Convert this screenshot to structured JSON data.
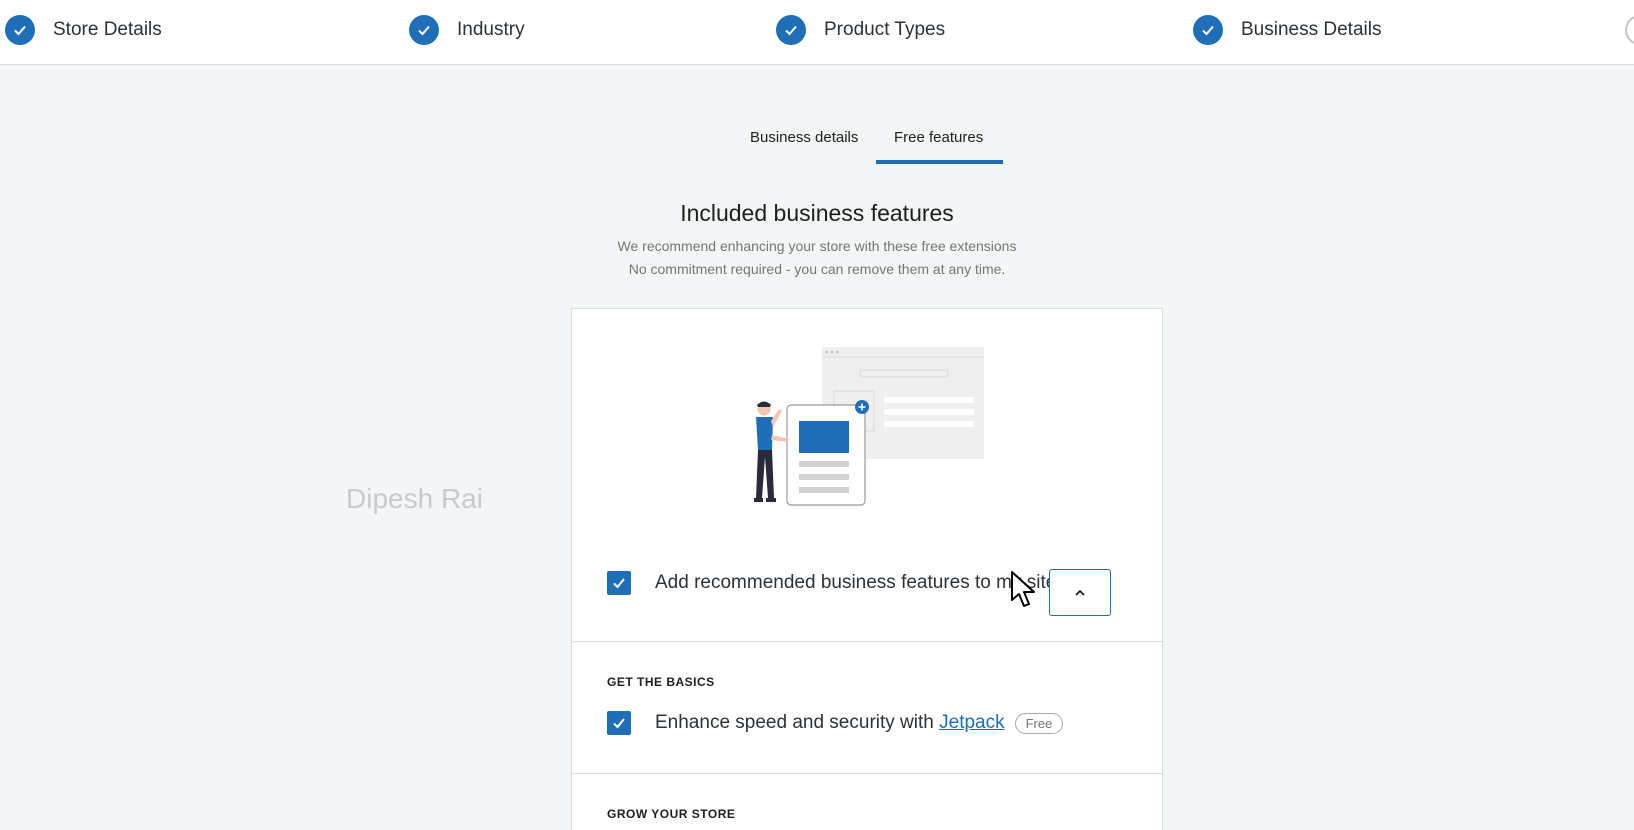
{
  "stepper": {
    "steps": [
      {
        "label": "Store Details"
      },
      {
        "label": "Industry"
      },
      {
        "label": "Product Types"
      },
      {
        "label": "Business Details"
      }
    ]
  },
  "tabs": [
    {
      "label": "Business details",
      "active": false
    },
    {
      "label": "Free features",
      "active": true
    }
  ],
  "header": {
    "title": "Included business features",
    "subtitle_line1": "We recommend enhancing your store with these free extensions",
    "subtitle_line2": "No commitment required - you can remove them at any time."
  },
  "watermark": "Dipesh Rai",
  "card": {
    "main_option": {
      "label": "Add recommended business features to my site",
      "checked": true
    },
    "sections": [
      {
        "title": "GET THE BASICS",
        "items": [
          {
            "prefix": "Enhance speed and security with ",
            "link": "Jetpack",
            "badge": "Free",
            "checked": true
          }
        ]
      },
      {
        "title": "GROW YOUR STORE",
        "items": []
      }
    ]
  },
  "colors": {
    "accent": "#1e6fb7",
    "background": "#f3f6f6"
  },
  "icons": [
    "check-icon",
    "chevron-up-icon",
    "mouse-cursor-icon"
  ]
}
